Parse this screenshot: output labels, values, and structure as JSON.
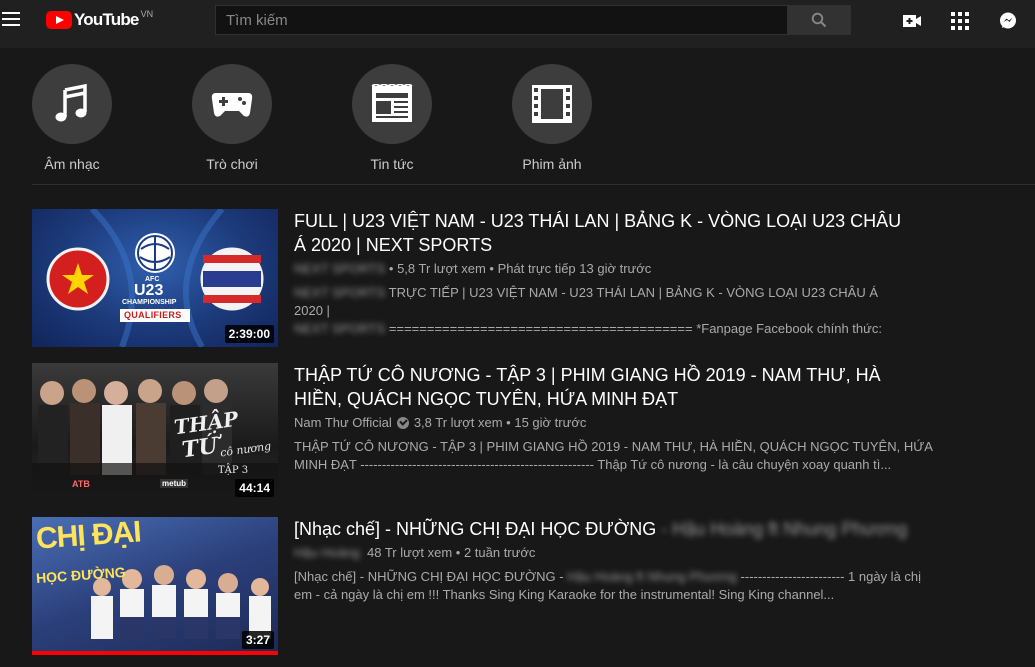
{
  "header": {
    "logo_text": "YouTube",
    "region": "VN",
    "search_placeholder": "Tìm kiếm"
  },
  "icons": {
    "menu": "menu-icon",
    "search": "search-icon",
    "upload": "create-video-icon",
    "apps": "apps-grid-icon",
    "messages": "messages-icon"
  },
  "categories": [
    {
      "label": "Âm nhạc",
      "icon": "music-note-icon"
    },
    {
      "label": "Trò chơi",
      "icon": "gamepad-icon"
    },
    {
      "label": "Tin tức",
      "icon": "newspaper-icon"
    },
    {
      "label": "Phim ảnh",
      "icon": "film-strip-icon"
    }
  ],
  "videos": [
    {
      "title": "FULL | U23 VIỆT NAM - U23 THÁI LAN | BẢNG K - VÒNG LOẠI U23 CHÂU Á 2020 | NEXT SPORTS",
      "channel": "NEXT SPORTS",
      "views": "5,8 Tr lượt xem",
      "age": "Phát trực tiếp 13 giờ trước",
      "desc_hidden_1": "NEXT SPORTS",
      "desc_1": "TRỰC TIẾP | U23 VIỆT NAM - U23 THÁI LAN | BẢNG K - VÒNG LOẠI U23 CHÂU Á 2020 |",
      "desc_hidden_2": "NEXT SPORTS",
      "desc_2": "======================================== *Fanpage Facebook chính thức:",
      "duration": "2:39:00",
      "thumb_labels": {
        "afc": "AFC",
        "u23": "U23",
        "championship": "CHAMPIONSHIP",
        "qualifiers": "QUALIFIERS"
      }
    },
    {
      "title": "THẬP TỨ CÔ NƯƠNG - TẬP 3 | PHIM GIANG HỒ 2019 - NAM THƯ, HÀ HIỀN, QUÁCH NGỌC TUYÊN, HỨA MINH ĐẠT",
      "channel": "Nam Thư Official",
      "views": "3,8 Tr lượt xem",
      "age": "15 giờ trước",
      "desc_1": "THẬP TỨ CÔ NƯƠNG - TẬP 3 | PHIM GIANG HỒ 2019 - NAM THƯ, HÀ HIỀN, QUÁCH NGỌC TUYÊN, HỨA",
      "desc_2": "MINH ĐẠT ------------------------------------------------------ Thập Tứ cô nương - là câu chuyện xoay quanh tì...",
      "duration": "44:14",
      "thumb_labels": {
        "title_a": "THẬP",
        "title_b": "TỨ",
        "title_c": "cô nương",
        "episode": "TẬP 3",
        "logo_a": "ATB",
        "logo_b": "metub"
      }
    },
    {
      "title": "[Nhạc chế] - NHỮNG CHỊ ĐẠI HỌC ĐƯỜNG",
      "title_hidden": "- Hậu Hoàng ft Nhung Phương",
      "channel": "Hậu Hoàng",
      "views": "48 Tr lượt xem",
      "age": "2 tuần trước",
      "desc_1_prefix": "[Nhạc chế] - NHỮNG CHỊ ĐẠI HỌC ĐƯỜNG -",
      "desc_hidden": "Hậu Hoàng ft Nhung Phương",
      "desc_1_suffix": "------------------------ 1 ngày là chị",
      "desc_2": "em - cả ngày là chị em !!! Thanks Sing King Karaoke for the instrumental! Sing King channel...",
      "duration": "3:27",
      "progress": 1.0,
      "thumb_labels": {
        "big": "CHỊ ĐẠI",
        "small": "HỌC ĐƯỜNG"
      }
    }
  ],
  "colors": {
    "background": "#181818",
    "header": "#202020",
    "brand_red": "#ff0000",
    "chip": "#3d3d3d"
  }
}
